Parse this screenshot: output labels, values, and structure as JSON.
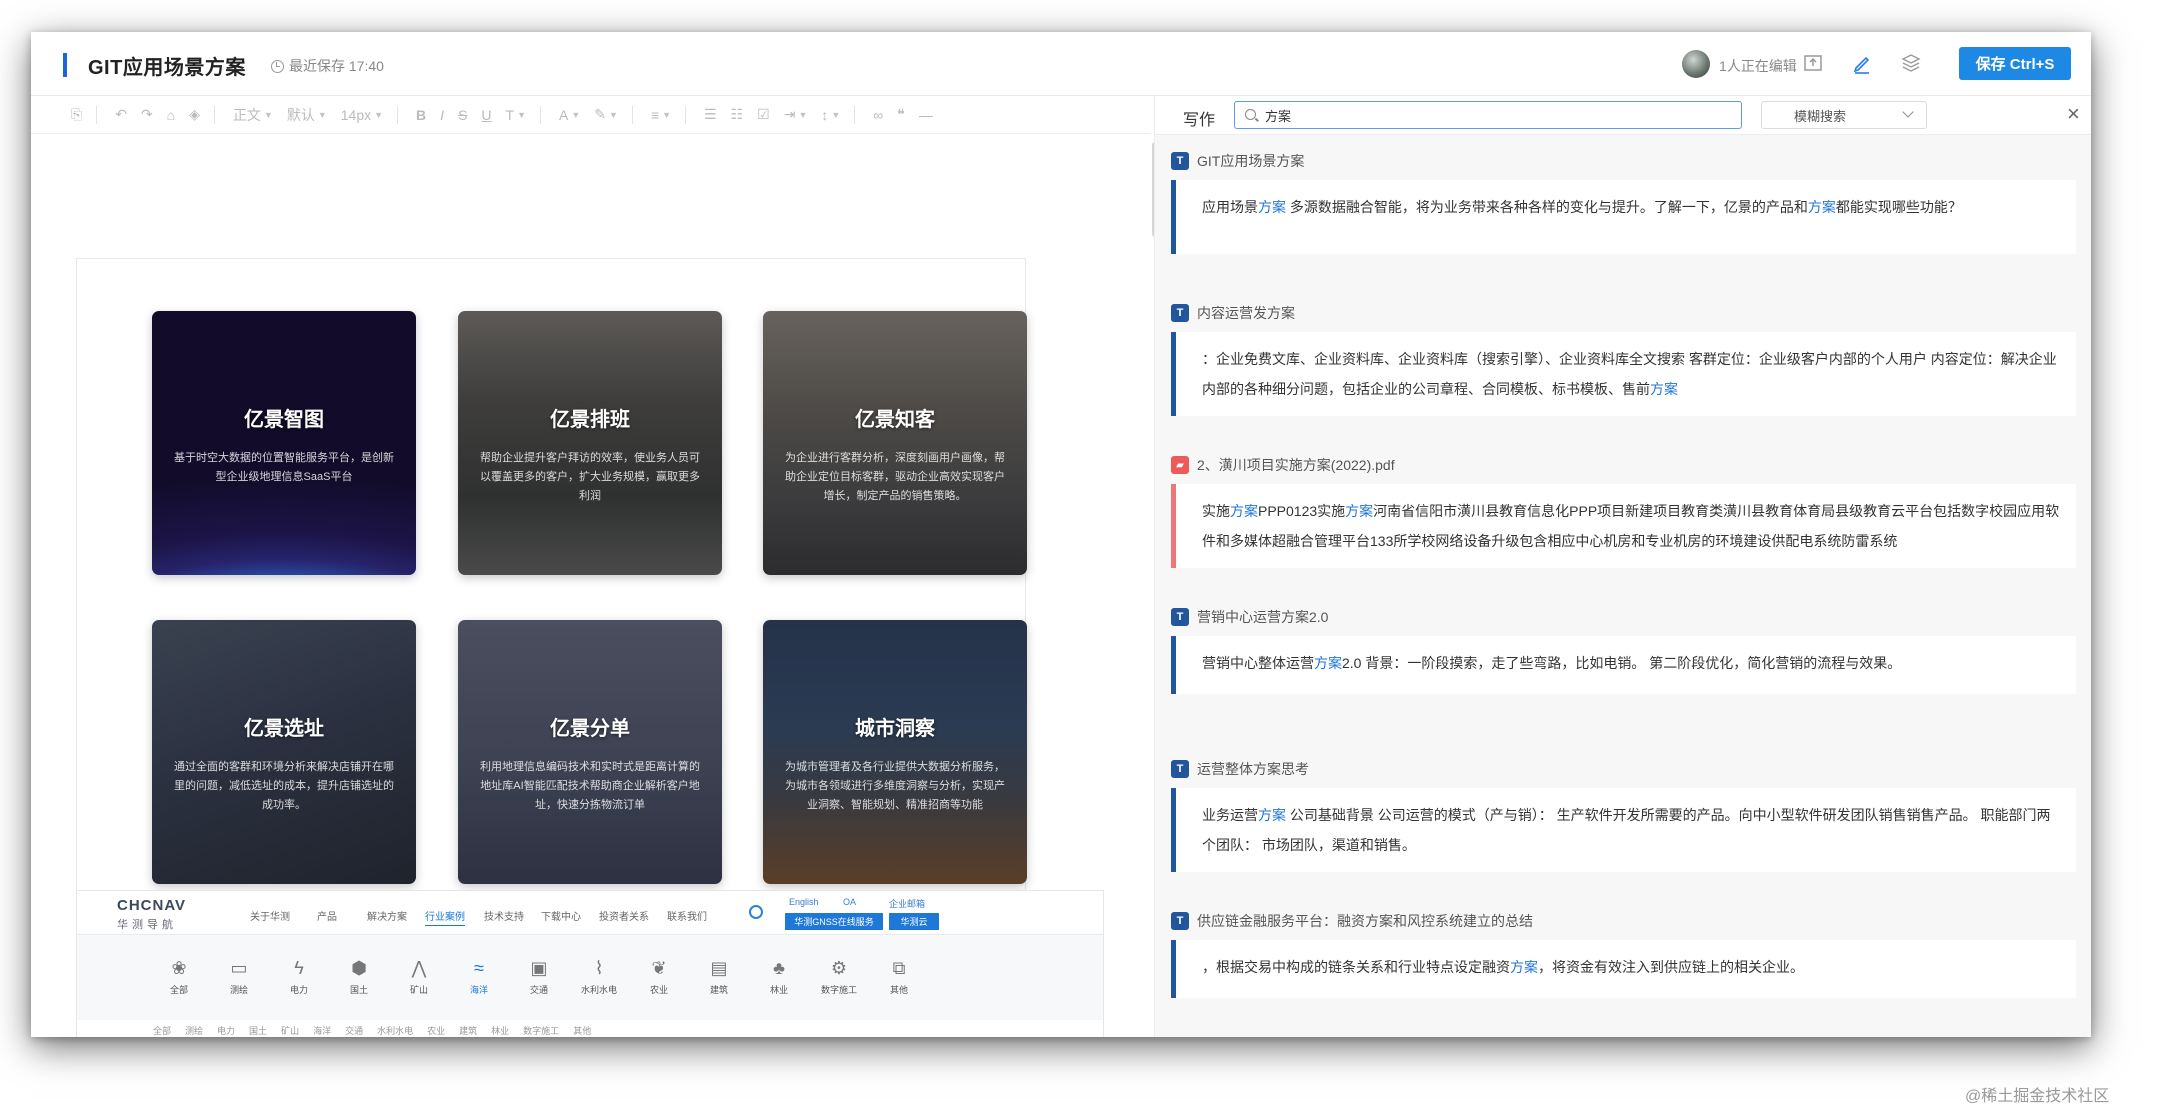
{
  "header": {
    "doc_title": "GIT应用场景方案",
    "save_info": "最近保存 17:40",
    "editing": "1人正在编辑",
    "save_button": "保存 Ctrl+S"
  },
  "toolbar": {
    "paragraph": "正文",
    "font": "默认",
    "size": "14px"
  },
  "cards": [
    {
      "title": "亿景智图",
      "desc": "基于时空大数据的位置智能服务平台，是创新型企业级地理信息SaaS平台"
    },
    {
      "title": "亿景排班",
      "desc": "帮助企业提升客户拜访的效率，使业务人员可以覆盖更多的客户，扩大业务规模，赢取更多利润"
    },
    {
      "title": "亿景知客",
      "desc": "为企业进行客群分析，深度刻画用户画像，帮助企业定位目标客群，驱动企业高效实现客户增长，制定产品的销售策略。"
    },
    {
      "title": "亿景选址",
      "desc": "通过全面的客群和环境分析来解决店铺开在哪里的问题，减低选址的成本，提升店铺选址的成功率。"
    },
    {
      "title": "亿景分单",
      "desc": "利用地理信息编码技术和实时式是距离计算的地址库AI智能匹配技术帮助商企业解析客户地址，快速分拣物流订单"
    },
    {
      "title": "城市洞察",
      "desc": "为城市管理者及各行业提供大数据分析服务，为城市各领域进行多维度洞察与分析，实现产业洞察、智能规划、精准招商等功能"
    }
  ],
  "site": {
    "logo": "CHCNAV",
    "logo_sub": "华测导航",
    "nav": [
      "关于华测",
      "产品",
      "解决方案",
      "行业案例",
      "技术支持",
      "下载中心",
      "投资者关系",
      "联系我们"
    ],
    "mini": [
      "English",
      "OA",
      "企业邮箱"
    ],
    "btn1": "华测GNSS在线服务",
    "btn2": "华测云",
    "cats": [
      "全部",
      "测绘",
      "电力",
      "国土",
      "矿山",
      "海洋",
      "交通",
      "水利水电",
      "农业",
      "建筑",
      "林业",
      "数字施工",
      "其他"
    ],
    "sub": [
      "全部",
      "测绘",
      "电力",
      "国土",
      "矿山",
      "海洋",
      "交通",
      "水利水电",
      "农业",
      "建筑",
      "林业",
      "数字施工",
      "其他"
    ]
  },
  "panel": {
    "label": "写作",
    "search_value": "方案",
    "mode": "模糊搜索"
  },
  "results": [
    {
      "title": "GIT应用场景方案",
      "pdf": false,
      "body": [
        [
          "应用场景",
          false
        ],
        [
          "方案",
          true
        ],
        [
          " 多源数据融合智能，将为业务带来各种各样的变化与提升。了解一下，亿景的产品和",
          false
        ],
        [
          "方案",
          true
        ],
        [
          "都能实现哪些功能？",
          false
        ]
      ]
    },
    {
      "title": "内容运营发方案",
      "pdf": false,
      "body": [
        [
          "：企业免费文库、企业资料库、企业资料库（搜索引擎）、企业资料库全文搜索 客群定位：企业级客户内部的个人用户 内容定位：解决企业内部的各种细分问题，包括企业的公司章程、合同模板、标书模板、售前",
          false
        ],
        [
          "方案",
          true
        ]
      ]
    },
    {
      "title": "2、潢川项目实施方案(2022).pdf",
      "pdf": true,
      "body": [
        [
          "实施",
          false
        ],
        [
          "方案",
          true
        ],
        [
          "PPP0123实施",
          false
        ],
        [
          "方案",
          true
        ],
        [
          "河南省信阳市潢川县教育信息化PPP项目新建项目教育类潢川县教育体育局县级教育云平台包括数字校园应用软件和多媒体超融合管理平台133所学校网络设备升级包含相应中心机房和专业机房的环境建设供配电系统防雷系统",
          false
        ]
      ]
    },
    {
      "title": "营销中心运营方案2.0",
      "pdf": false,
      "body": [
        [
          "营销中心整体运营",
          false
        ],
        [
          "方案",
          true
        ],
        [
          "2.0 背景：一阶段摸索，走了些弯路，比如电销。 第二阶段优化，简化营销的流程与效果。",
          false
        ]
      ]
    },
    {
      "title": "运营整体方案思考",
      "pdf": false,
      "body": [
        [
          "业务运营",
          false
        ],
        [
          "方案",
          true
        ],
        [
          " 公司基础背景 公司运营的模式（产与销）： 生产软件开发所需要的产品。向中小型软件研发团队销售销售产品。 职能部门两个团队： 市场团队，渠道和销售。",
          false
        ]
      ]
    },
    {
      "title": "供应链金融服务平台：融资方案和风控系统建立的总结",
      "pdf": false,
      "body": [
        [
          "，根据交易中构成的链条关系和行业特点设定融资",
          false
        ],
        [
          "方案",
          true
        ],
        [
          "，将资金有效注入到供应链上的相关企业。",
          false
        ]
      ]
    }
  ],
  "watermark": "@稀土掘金技术社区"
}
